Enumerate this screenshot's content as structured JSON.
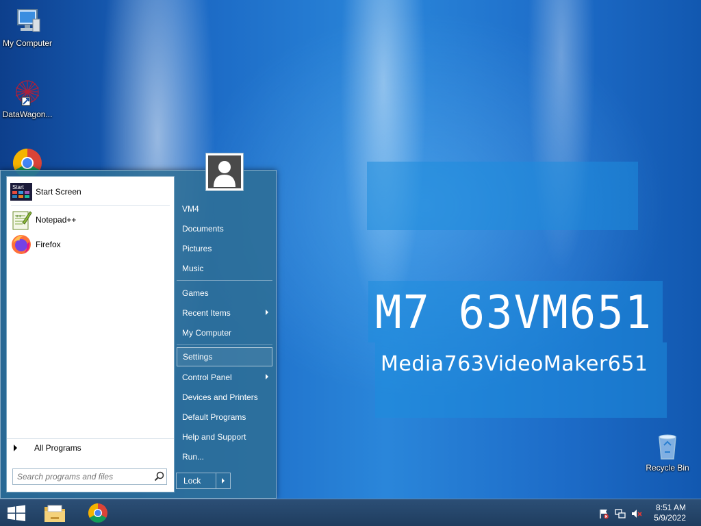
{
  "desktop": {
    "icons": [
      {
        "label": "My Computer"
      },
      {
        "label": "DataWagon..."
      },
      {
        "label": "Google Chrome"
      },
      {
        "label": "Recycle Bin"
      }
    ],
    "watermark": {
      "code": "M7 63VM651",
      "name": "Media763VideoMaker651"
    }
  },
  "start_menu": {
    "pinned": [
      {
        "label": "Start Screen",
        "icon": "start-screen-icon"
      },
      {
        "label": "Notepad++",
        "icon": "notepadpp-icon"
      },
      {
        "label": "Firefox",
        "icon": "firefox-icon"
      }
    ],
    "all_programs": "All Programs",
    "search_placeholder": "Search programs and files",
    "right_items": [
      {
        "label": "VM4"
      },
      {
        "label": "Documents"
      },
      {
        "label": "Pictures"
      },
      {
        "label": "Music"
      },
      {
        "label": "Games"
      },
      {
        "label": "Recent Items"
      },
      {
        "label": "My Computer"
      },
      {
        "label": "Settings"
      },
      {
        "label": "Control Panel"
      },
      {
        "label": "Devices and Printers"
      },
      {
        "label": "Default Programs"
      },
      {
        "label": "Help and Support"
      },
      {
        "label": "Run..."
      }
    ],
    "lock_label": "Lock"
  },
  "taskbar": {
    "time": "8:51 AM",
    "date": "5/9/2022"
  }
}
